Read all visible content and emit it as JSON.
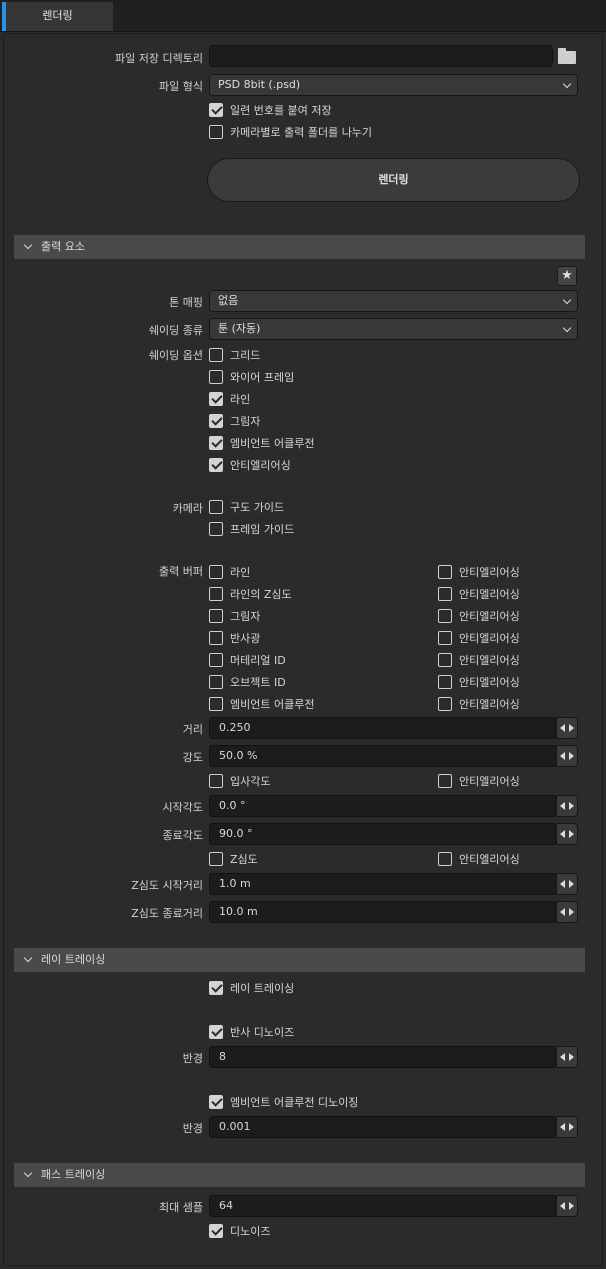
{
  "tab": {
    "label": "렌더링"
  },
  "file": {
    "dir_label": "파일 저장 디렉토리",
    "dir_value": "",
    "format_label": "파일 형식",
    "format_value": "PSD 8bit (.psd)",
    "serial_label": "일련 번호를 붙여 저장",
    "serial_checked": true,
    "percam_label": "카메라별로 출력 폴더를 나누기",
    "percam_checked": false,
    "render_button": "렌더링"
  },
  "output": {
    "section_title": "출력 요소",
    "tone_label": "톤 매핑",
    "tone_value": "없음",
    "shading_label": "쉐이딩 종류",
    "shading_value": "툰 (자동)",
    "options_label": "쉐이딩 옵션",
    "options": [
      {
        "label": "그리드",
        "checked": false
      },
      {
        "label": "와이어 프레임",
        "checked": false
      },
      {
        "label": "라인",
        "checked": true
      },
      {
        "label": "그림자",
        "checked": true
      },
      {
        "label": "엠비언트 어클루전",
        "checked": true
      },
      {
        "label": "안티엘리어싱",
        "checked": true
      }
    ],
    "camera_label": "카메라",
    "camera": [
      {
        "label": "구도 가이드",
        "checked": false
      },
      {
        "label": "프레임 가이드",
        "checked": false
      }
    ],
    "buffer_label": "출력 버퍼",
    "buffers": [
      {
        "label": "라인",
        "checked": false,
        "aa": "안티엘리어싱",
        "aa_checked": false
      },
      {
        "label": "라인의 Z심도",
        "checked": false,
        "aa": "안티엘리어싱",
        "aa_checked": false
      },
      {
        "label": "그림자",
        "checked": false,
        "aa": "안티엘리어싱",
        "aa_checked": false
      },
      {
        "label": "반사광",
        "checked": false,
        "aa": "안티엘리어싱",
        "aa_checked": false
      },
      {
        "label": "머테리얼 ID",
        "checked": false,
        "aa": "안티엘리어싱",
        "aa_checked": false
      },
      {
        "label": "오브젝트 ID",
        "checked": false,
        "aa": "안티엘리어싱",
        "aa_checked": false
      },
      {
        "label": "엠비언트 어클루전",
        "checked": false,
        "aa": "안티엘리어싱",
        "aa_checked": false
      }
    ],
    "distance_label": "거리",
    "distance_value": "0.250",
    "intensity_label": "강도",
    "intensity_value": "50.0 %",
    "incidence_label": "입사각도",
    "incidence_checked": false,
    "incidence_aa": "안티엘리어싱",
    "incidence_aa_checked": false,
    "start_angle_label": "시작각도",
    "start_angle_value": "0.0 °",
    "end_angle_label": "종료각도",
    "end_angle_value": "90.0 °",
    "zdepth_label": "Z심도",
    "zdepth_checked": false,
    "zdepth_aa": "안티엘리어싱",
    "zdepth_aa_checked": false,
    "z_start_label": "Z심도 시작거리",
    "z_start_value": "1.0 m",
    "z_end_label": "Z심도 종료거리",
    "z_end_value": "10.0 m"
  },
  "raytracing": {
    "section_title": "레이 트레이싱",
    "enable_label": "레이 트레이싱",
    "enable_checked": true,
    "reflect_denoise_label": "반사 디노이즈",
    "reflect_denoise_checked": true,
    "radius_label": "반경",
    "radius_value": "8",
    "ao_denoise_label": "엠비언트 어클루전 디노이징",
    "ao_denoise_checked": true,
    "radius2_label": "반경",
    "radius2_value": "0.001"
  },
  "pathtracing": {
    "section_title": "패스 트레이싱",
    "max_samples_label": "최대 샘플",
    "max_samples_value": "64",
    "denoise_label": "디노이즈",
    "denoise_checked": true
  }
}
